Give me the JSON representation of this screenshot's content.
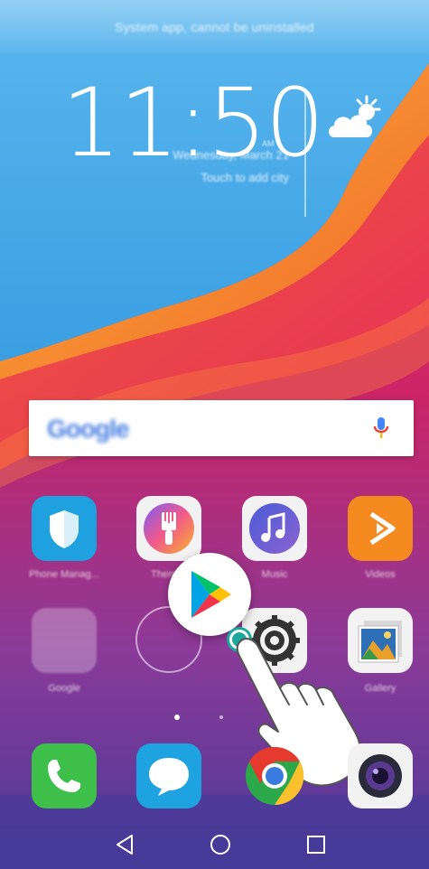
{
  "status": {
    "toast": "System app, cannot be uninstalled"
  },
  "clock_widget": {
    "time": "11:50",
    "ampm": "AM",
    "date": "Wednesday, March 21",
    "city_prompt": "Touch to add city",
    "weather_icon": "partly-cloudy-icon"
  },
  "search_widget": {
    "brand": "Google",
    "mic_icon": "mic-icon"
  },
  "apps_row1": [
    {
      "name": "phone-manager-app",
      "label": "Phone Manag...",
      "icon": "shield-icon"
    },
    {
      "name": "themes-app",
      "label": "Themes",
      "icon": "paintbrush-icon"
    },
    {
      "name": "music-app",
      "label": "Music",
      "icon": "music-note-icon"
    },
    {
      "name": "videos-app",
      "label": "Videos",
      "icon": "play-triangle-icon"
    }
  ],
  "apps_row2": [
    {
      "name": "google-folder",
      "label": "Google",
      "icon": "folder-icon"
    },
    {
      "name": "empty-slot",
      "label": "",
      "icon": "circle-outline-icon"
    },
    {
      "name": "settings-app",
      "label": "Settings",
      "icon": "gear-icon"
    },
    {
      "name": "gallery-app",
      "label": "Gallery",
      "icon": "photos-icon"
    }
  ],
  "dragging": {
    "app": "Play Store",
    "icon": "play-store-icon",
    "hand_icon": "hand-pointer-icon"
  },
  "page_indicator": {
    "pages": 2,
    "active": 1
  },
  "dock": [
    {
      "name": "dock-phone",
      "icon": "phone-icon"
    },
    {
      "name": "dock-messaging",
      "icon": "chat-bubble-icon"
    },
    {
      "name": "dock-chrome",
      "icon": "chrome-icon"
    },
    {
      "name": "dock-camera",
      "icon": "camera-icon"
    }
  ],
  "navbar": {
    "back_icon": "back-triangle-icon",
    "home_icon": "home-circle-icon",
    "recents_icon": "recents-square-icon"
  },
  "colors": {
    "sky": "#3ea4e6",
    "orange": "#f59a2a",
    "red": "#e8334d",
    "magenta": "#d0246a",
    "purple": "#6a3ea0"
  }
}
